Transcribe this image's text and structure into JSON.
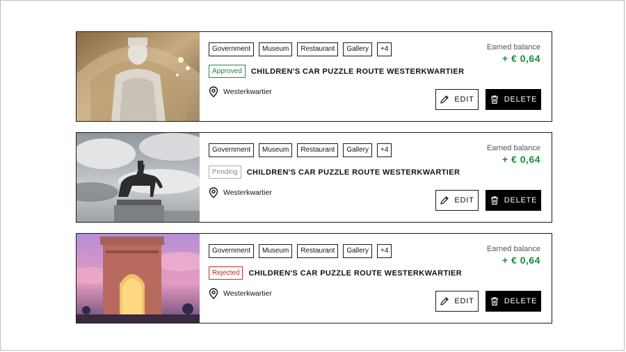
{
  "tags_label": "tags",
  "listings": [
    {
      "tags": [
        "Government",
        "Museum",
        "Restaurant",
        "Gallery",
        "+4"
      ],
      "status": "Approved",
      "title": "CHILDREN'S CAR PUZZLE ROUTE WESTERKWARTIER",
      "location": "Westerkwartier",
      "balance_label": "Earned balance",
      "balance_amount": "+ € 0,64",
      "edit_label": "EDIT",
      "delete_label": "DELETE"
    },
    {
      "tags": [
        "Government",
        "Museum",
        "Restaurant",
        "Gallery",
        "+4"
      ],
      "status": "Pending",
      "title": "CHILDREN'S CAR PUZZLE ROUTE WESTERKWARTIER",
      "location": "Westerkwartier",
      "balance_label": "Earned balance",
      "balance_amount": "+ € 0,64",
      "edit_label": "EDIT",
      "delete_label": "DELETE"
    },
    {
      "tags": [
        "Government",
        "Museum",
        "Restaurant",
        "Gallery",
        "+4"
      ],
      "status": "Rejected",
      "title": "CHILDREN'S CAR PUZZLE ROUTE WESTERKWARTIER",
      "location": "Westerkwartier",
      "balance_label": "Earned balance",
      "balance_amount": "+ € 0,64",
      "edit_label": "EDIT",
      "delete_label": "DELETE"
    }
  ],
  "colors": {
    "approved": "#1c8a3d",
    "pending": "#8d8d8d",
    "rejected": "#c02b2b",
    "balance": "#1c8a3d"
  },
  "icons": [
    "location-pin-icon",
    "pencil-icon",
    "trash-icon"
  ]
}
